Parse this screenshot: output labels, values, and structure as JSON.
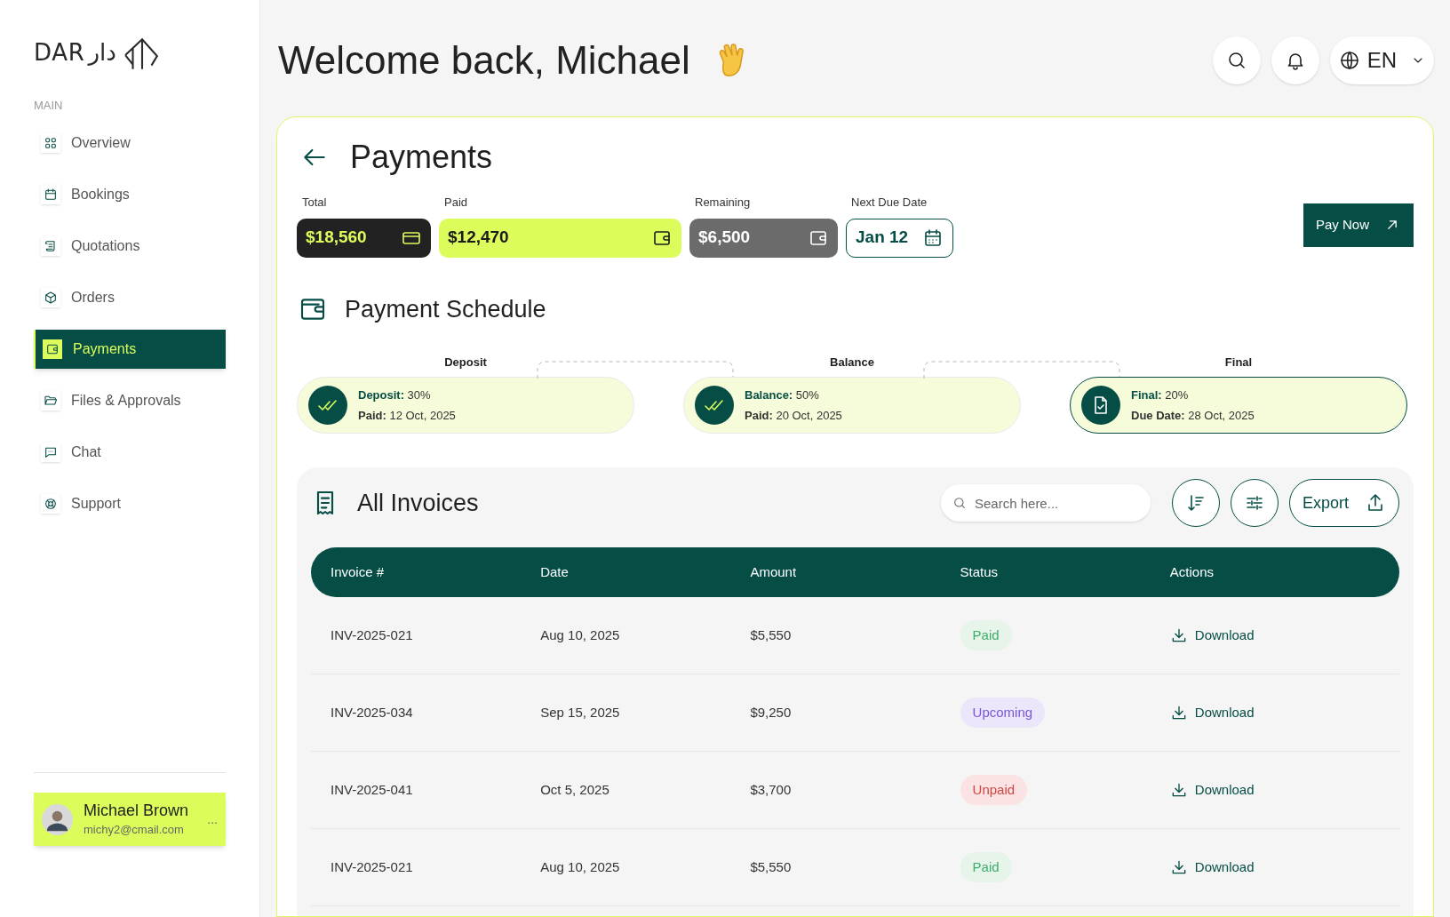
{
  "logo": {
    "latin": "DAR",
    "arabic": "دار"
  },
  "sidebar": {
    "section": "MAIN",
    "items": [
      {
        "label": "Overview",
        "kind": "grid",
        "selected": false
      },
      {
        "label": "Bookings",
        "kind": "calendar",
        "selected": false
      },
      {
        "label": "Quotations",
        "kind": "scroll",
        "selected": false
      },
      {
        "label": "Orders",
        "kind": "box",
        "selected": false
      },
      {
        "label": "Payments",
        "kind": "wallet",
        "selected": true
      },
      {
        "label": "Files & Approvals",
        "kind": "folder",
        "selected": false
      },
      {
        "label": "Chat",
        "kind": "chat",
        "selected": false
      },
      {
        "label": "Support",
        "kind": "lifebuoy",
        "selected": false
      }
    ],
    "user": {
      "name": "Michael Brown",
      "email": "michy2@cmail.com",
      "more": "..."
    }
  },
  "header": {
    "greeting": "Welcome back, Michael",
    "language": "EN"
  },
  "page": {
    "title": "Payments",
    "summary": [
      {
        "label": "Total",
        "value": "$18,560",
        "kind": "dark"
      },
      {
        "label": "Paid",
        "value": "$12,470",
        "kind": "lime"
      },
      {
        "label": "Remaining",
        "value": "$6,500",
        "kind": "grey"
      },
      {
        "label": "Next Due Date",
        "value": "Jan 12",
        "kind": "outline"
      }
    ],
    "pay_button": "Pay Now",
    "schedule": {
      "title": "Payment Schedule",
      "steps": [
        {
          "title": "Deposit",
          "line1": "**Deposit:** 30%",
          "line2": "**Paid:** 12 Oct, 2025",
          "kind": "paid"
        },
        {
          "title": "Balance",
          "line1": "**Balance:** 50%",
          "line2": "**Paid:** 20 Oct, 2025",
          "kind": "paid"
        },
        {
          "title": "Final",
          "line1": "**Final:** 20%",
          "line2": "**Due Date:** 28 Oct, 2025",
          "kind": "due"
        }
      ]
    },
    "invoices": {
      "title": "All Invoices",
      "search": {
        "placeholder": "Search here..."
      },
      "export": "Export",
      "columns": [
        "Invoice #",
        "Date",
        "Amount",
        "Status",
        "Actions"
      ],
      "rows": [
        {
          "invoice": "INV-2025-021",
          "date": "Aug 10, 2025",
          "amount": "$5,550",
          "status": "Paid",
          "kind": "paid",
          "action": "Download"
        },
        {
          "invoice": "INV-2025-034",
          "date": "Sep 15, 2025",
          "amount": "$9,250",
          "status": "Upcoming",
          "kind": "upcoming",
          "action": "Download"
        },
        {
          "invoice": "INV-2025-041",
          "date": "Oct 5, 2025",
          "amount": "$3,700",
          "status": "Unpaid",
          "kind": "unpaid",
          "action": "Download"
        },
        {
          "invoice": "INV-2025-021",
          "date": "Aug 10, 2025",
          "amount": "$5,550",
          "status": "Paid",
          "kind": "paid",
          "action": "Download"
        }
      ]
    }
  }
}
